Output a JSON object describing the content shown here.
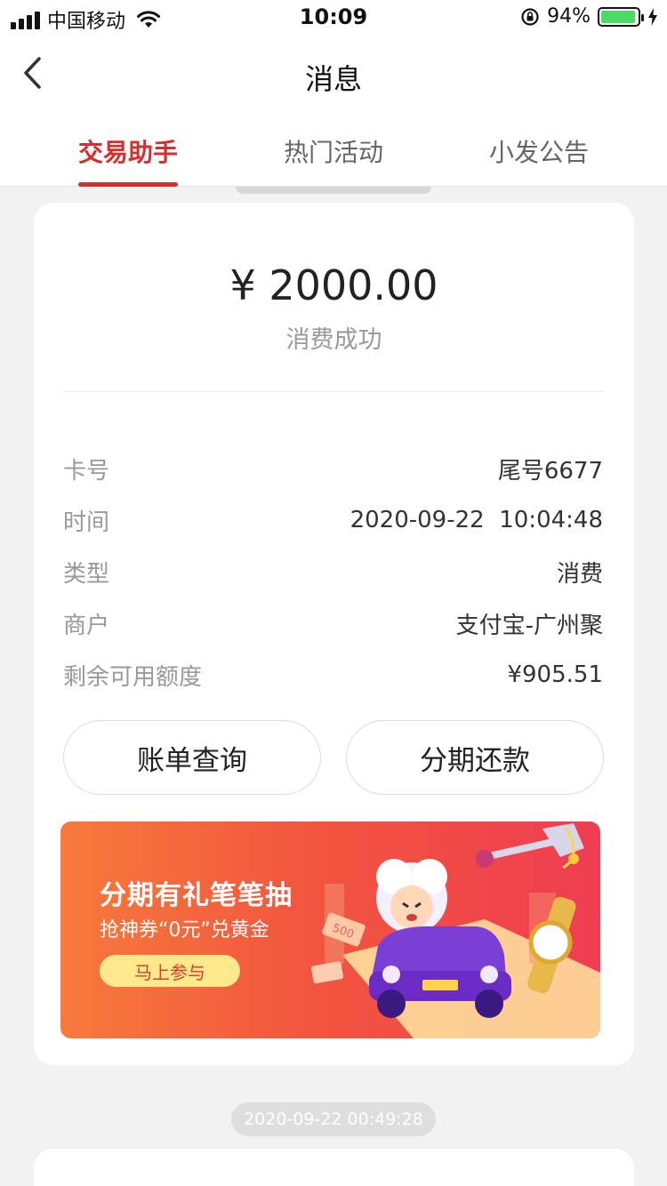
{
  "status_bar": {
    "carrier": "中国移动",
    "time": "10:09",
    "battery": "94%",
    "battery_level": 0.94
  },
  "nav": {
    "title": "消息"
  },
  "tabs": [
    {
      "label": "交易助手",
      "active": true
    },
    {
      "label": "热门活动",
      "active": false
    },
    {
      "label": "小发公告",
      "active": false
    }
  ],
  "transaction": {
    "amount": "¥ 2000.00",
    "status": "消费成功",
    "details": [
      {
        "key": "卡号",
        "value": "尾号6677"
      },
      {
        "key": "时间",
        "value": "2020-09-22  10:04:48"
      },
      {
        "key": "类型",
        "value": "消费"
      },
      {
        "key": "商户",
        "value": "支付宝-广州聚"
      },
      {
        "key": "剩余可用额度",
        "value": "¥905.51"
      }
    ],
    "buttons": {
      "bill": "账单查询",
      "installment": "分期还款"
    }
  },
  "banner": {
    "title": "分期有礼笔笔抽",
    "subtitle": "抢神券“0元”兑黄金",
    "cta": "马上参与",
    "note_label": "500"
  },
  "next_timestamp": "2020-09-22 00:49:28",
  "colors": {
    "accent": "#d42e2e",
    "banner_start": "#f77a3c",
    "banner_end": "#ef3d52",
    "cta_bg": "#ffe98c"
  }
}
